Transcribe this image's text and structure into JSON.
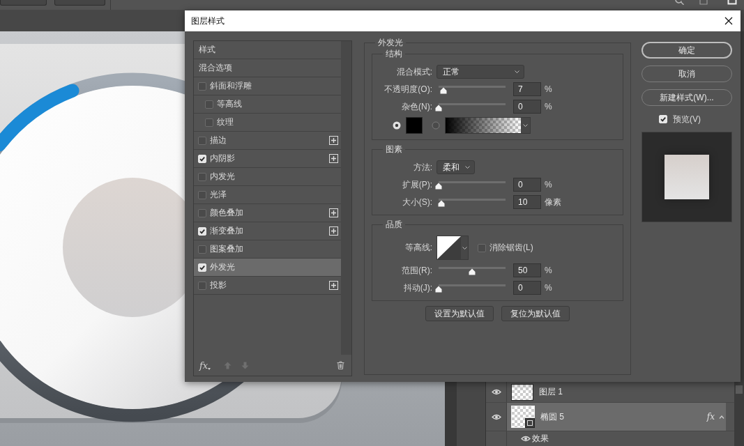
{
  "dialog": {
    "title": "图层样式",
    "styles": [
      {
        "kind": "header",
        "label": "样式",
        "selected": false
      },
      {
        "kind": "header",
        "label": "混合选项",
        "selected": false
      },
      {
        "kind": "effect",
        "label": "斜面和浮雕",
        "checked": false,
        "selected": false,
        "add_button": false,
        "children": [
          {
            "kind": "effect",
            "label": "等高线",
            "checked": false,
            "selected": false,
            "add_button": false
          },
          {
            "kind": "effect",
            "label": "纹理",
            "checked": false,
            "selected": false,
            "add_button": false
          }
        ]
      },
      {
        "kind": "effect",
        "label": "描边",
        "checked": false,
        "selected": false,
        "add_button": true
      },
      {
        "kind": "effect",
        "label": "内阴影",
        "checked": true,
        "selected": false,
        "add_button": true
      },
      {
        "kind": "effect",
        "label": "内发光",
        "checked": false,
        "selected": false,
        "add_button": false
      },
      {
        "kind": "effect",
        "label": "光泽",
        "checked": false,
        "selected": false,
        "add_button": false
      },
      {
        "kind": "effect",
        "label": "颜色叠加",
        "checked": false,
        "selected": false,
        "add_button": true
      },
      {
        "kind": "effect",
        "label": "渐变叠加",
        "checked": true,
        "selected": false,
        "add_button": true
      },
      {
        "kind": "effect",
        "label": "图案叠加",
        "checked": false,
        "selected": false,
        "add_button": false
      },
      {
        "kind": "effect",
        "label": "外发光",
        "checked": true,
        "selected": true,
        "add_button": false
      },
      {
        "kind": "effect",
        "label": "投影",
        "checked": false,
        "selected": false,
        "add_button": true
      }
    ],
    "footer": {
      "fx_button": "fx"
    },
    "panel": {
      "title": "外发光",
      "groups": [
        {
          "title": "结构",
          "rows": [
            {
              "kind": "select",
              "label": "混合模式:",
              "value": "正常"
            },
            {
              "kind": "slider",
              "label": "不透明度(O):",
              "level": 0.07,
              "value": "7",
              "unit": "%"
            },
            {
              "kind": "slider",
              "label": "杂色(N):",
              "level": 0,
              "value": "0",
              "unit": "%"
            },
            {
              "kind": "color_source",
              "options": [
                {
                  "kind": "swatch",
                  "selected": true,
                  "color": "#000000"
                },
                {
                  "kind": "gradient",
                  "selected": false
                }
              ]
            }
          ]
        },
        {
          "title": "图素",
          "rows": [
            {
              "kind": "select",
              "label": "方法:",
              "value": "柔和"
            },
            {
              "kind": "slider",
              "label": "扩展(P):",
              "level": 0,
              "value": "0",
              "unit": "%"
            },
            {
              "kind": "slider",
              "label": "大小(S):",
              "level": 0.04,
              "value": "10",
              "unit": "像素"
            }
          ]
        },
        {
          "title": "品质",
          "rows": [
            {
              "kind": "contour",
              "label": "等高线:",
              "checkbox": {
                "label": "消除锯齿(L)",
                "checked": false
              }
            },
            {
              "kind": "slider",
              "label": "范围(R):",
              "level": 0.5,
              "value": "50",
              "unit": "%"
            },
            {
              "kind": "slider",
              "label": "抖动(J):",
              "level": 0,
              "value": "0",
              "unit": "%"
            }
          ]
        }
      ],
      "buttons": [
        {
          "label": "设置为默认值"
        },
        {
          "label": "复位为默认值"
        }
      ]
    },
    "actions": [
      {
        "label": "确定",
        "default": true
      },
      {
        "label": "取消",
        "default": false
      },
      {
        "label": "新建样式(W)...",
        "default": false
      }
    ],
    "preview": {
      "label": "预览(V)",
      "checked": true
    }
  },
  "layers": [
    {
      "kind": "pixel",
      "name": "图层 1",
      "visible": true,
      "selected": false
    },
    {
      "kind": "shape",
      "name": "椭圆 5",
      "visible": true,
      "selected": true,
      "badge": "fx",
      "expanded": true,
      "children": [
        {
          "name": "效果",
          "visible": true
        }
      ]
    }
  ]
}
